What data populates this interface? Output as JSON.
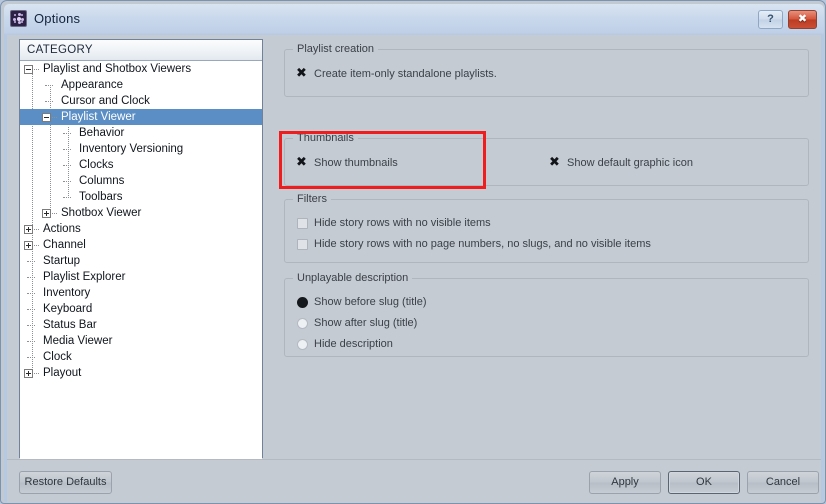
{
  "window": {
    "title": "Options",
    "icon": "options-app-icon",
    "help_button": "?",
    "close_button": "✖"
  },
  "sidebar": {
    "header": "CATEGORY",
    "items": [
      {
        "label": "Playlist and Shotbox Viewers",
        "level": 0,
        "expander": "minus",
        "selected": false
      },
      {
        "label": "Appearance",
        "level": 1,
        "expander": "none",
        "selected": false
      },
      {
        "label": "Cursor and Clock",
        "level": 1,
        "expander": "none",
        "selected": false
      },
      {
        "label": "Playlist Viewer",
        "level": 1,
        "expander": "minus",
        "selected": true
      },
      {
        "label": "Behavior",
        "level": 2,
        "expander": "none",
        "selected": false
      },
      {
        "label": "Inventory Versioning",
        "level": 2,
        "expander": "none",
        "selected": false
      },
      {
        "label": "Clocks",
        "level": 2,
        "expander": "none",
        "selected": false
      },
      {
        "label": "Columns",
        "level": 2,
        "expander": "none",
        "selected": false
      },
      {
        "label": "Toolbars",
        "level": 2,
        "expander": "none",
        "selected": false
      },
      {
        "label": "Shotbox Viewer",
        "level": 1,
        "expander": "plus",
        "selected": false
      },
      {
        "label": "Actions",
        "level": 0,
        "expander": "plus",
        "selected": false
      },
      {
        "label": "Channel",
        "level": 0,
        "expander": "plus",
        "selected": false
      },
      {
        "label": "Startup",
        "level": 0,
        "expander": "none",
        "selected": false
      },
      {
        "label": "Playlist Explorer",
        "level": 0,
        "expander": "none",
        "selected": false
      },
      {
        "label": "Inventory",
        "level": 0,
        "expander": "none",
        "selected": false
      },
      {
        "label": "Keyboard",
        "level": 0,
        "expander": "none",
        "selected": false
      },
      {
        "label": "Status Bar",
        "level": 0,
        "expander": "none",
        "selected": false
      },
      {
        "label": "Media Viewer",
        "level": 0,
        "expander": "none",
        "selected": false
      },
      {
        "label": "Clock",
        "level": 0,
        "expander": "none",
        "selected": false
      },
      {
        "label": "Playout",
        "level": 0,
        "expander": "plus",
        "selected": false
      }
    ]
  },
  "main": {
    "groups": [
      {
        "title": "Playlist creation",
        "checkboxes": [
          {
            "label": "Create item-only standalone playlists.",
            "checked": true
          }
        ]
      },
      {
        "title": "Thumbnails",
        "highlighted": true,
        "checkboxes": [
          {
            "label": "Show thumbnails",
            "checked": true
          },
          {
            "label": "Show default graphic icon",
            "checked": true
          }
        ]
      },
      {
        "title": "Filters",
        "checkboxes": [
          {
            "label": "Hide story rows with no visible items",
            "checked": false
          },
          {
            "label": "Hide story rows with no page numbers, no slugs, and no visible items",
            "checked": false
          }
        ]
      },
      {
        "title": "Unplayable description",
        "radios": [
          {
            "label": "Show before slug (title)",
            "selected": true
          },
          {
            "label": "Show after slug (title)",
            "selected": false
          },
          {
            "label": "Hide description",
            "selected": false
          }
        ]
      }
    ]
  },
  "footer": {
    "restore_defaults": "Restore Defaults",
    "apply": "Apply",
    "ok": "OK",
    "cancel": "Cancel"
  },
  "colors": {
    "highlight_red": "#ef1d1d",
    "selection_blue": "#5b8ec4",
    "dialog_bg": "#c5cbd3",
    "close_button_red": "#c9492f"
  }
}
